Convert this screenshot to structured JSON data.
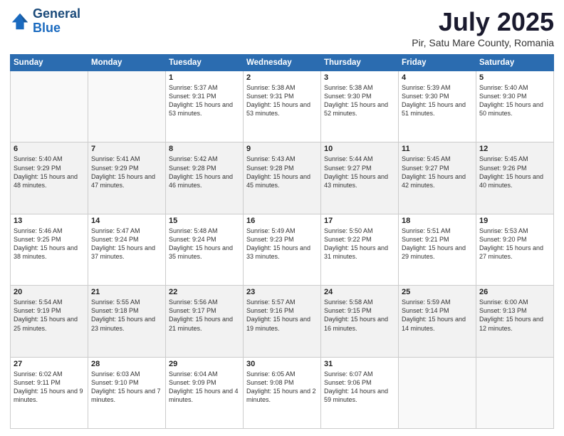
{
  "logo": {
    "line1": "General",
    "line2": "Blue"
  },
  "title": "July 2025",
  "subtitle": "Pir, Satu Mare County, Romania",
  "days_header": [
    "Sunday",
    "Monday",
    "Tuesday",
    "Wednesday",
    "Thursday",
    "Friday",
    "Saturday"
  ],
  "weeks": [
    [
      {
        "day": "",
        "info": ""
      },
      {
        "day": "",
        "info": ""
      },
      {
        "day": "1",
        "info": "Sunrise: 5:37 AM\nSunset: 9:31 PM\nDaylight: 15 hours and 53 minutes."
      },
      {
        "day": "2",
        "info": "Sunrise: 5:38 AM\nSunset: 9:31 PM\nDaylight: 15 hours and 53 minutes."
      },
      {
        "day": "3",
        "info": "Sunrise: 5:38 AM\nSunset: 9:30 PM\nDaylight: 15 hours and 52 minutes."
      },
      {
        "day": "4",
        "info": "Sunrise: 5:39 AM\nSunset: 9:30 PM\nDaylight: 15 hours and 51 minutes."
      },
      {
        "day": "5",
        "info": "Sunrise: 5:40 AM\nSunset: 9:30 PM\nDaylight: 15 hours and 50 minutes."
      }
    ],
    [
      {
        "day": "6",
        "info": "Sunrise: 5:40 AM\nSunset: 9:29 PM\nDaylight: 15 hours and 48 minutes."
      },
      {
        "day": "7",
        "info": "Sunrise: 5:41 AM\nSunset: 9:29 PM\nDaylight: 15 hours and 47 minutes."
      },
      {
        "day": "8",
        "info": "Sunrise: 5:42 AM\nSunset: 9:28 PM\nDaylight: 15 hours and 46 minutes."
      },
      {
        "day": "9",
        "info": "Sunrise: 5:43 AM\nSunset: 9:28 PM\nDaylight: 15 hours and 45 minutes."
      },
      {
        "day": "10",
        "info": "Sunrise: 5:44 AM\nSunset: 9:27 PM\nDaylight: 15 hours and 43 minutes."
      },
      {
        "day": "11",
        "info": "Sunrise: 5:45 AM\nSunset: 9:27 PM\nDaylight: 15 hours and 42 minutes."
      },
      {
        "day": "12",
        "info": "Sunrise: 5:45 AM\nSunset: 9:26 PM\nDaylight: 15 hours and 40 minutes."
      }
    ],
    [
      {
        "day": "13",
        "info": "Sunrise: 5:46 AM\nSunset: 9:25 PM\nDaylight: 15 hours and 38 minutes."
      },
      {
        "day": "14",
        "info": "Sunrise: 5:47 AM\nSunset: 9:24 PM\nDaylight: 15 hours and 37 minutes."
      },
      {
        "day": "15",
        "info": "Sunrise: 5:48 AM\nSunset: 9:24 PM\nDaylight: 15 hours and 35 minutes."
      },
      {
        "day": "16",
        "info": "Sunrise: 5:49 AM\nSunset: 9:23 PM\nDaylight: 15 hours and 33 minutes."
      },
      {
        "day": "17",
        "info": "Sunrise: 5:50 AM\nSunset: 9:22 PM\nDaylight: 15 hours and 31 minutes."
      },
      {
        "day": "18",
        "info": "Sunrise: 5:51 AM\nSunset: 9:21 PM\nDaylight: 15 hours and 29 minutes."
      },
      {
        "day": "19",
        "info": "Sunrise: 5:53 AM\nSunset: 9:20 PM\nDaylight: 15 hours and 27 minutes."
      }
    ],
    [
      {
        "day": "20",
        "info": "Sunrise: 5:54 AM\nSunset: 9:19 PM\nDaylight: 15 hours and 25 minutes."
      },
      {
        "day": "21",
        "info": "Sunrise: 5:55 AM\nSunset: 9:18 PM\nDaylight: 15 hours and 23 minutes."
      },
      {
        "day": "22",
        "info": "Sunrise: 5:56 AM\nSunset: 9:17 PM\nDaylight: 15 hours and 21 minutes."
      },
      {
        "day": "23",
        "info": "Sunrise: 5:57 AM\nSunset: 9:16 PM\nDaylight: 15 hours and 19 minutes."
      },
      {
        "day": "24",
        "info": "Sunrise: 5:58 AM\nSunset: 9:15 PM\nDaylight: 15 hours and 16 minutes."
      },
      {
        "day": "25",
        "info": "Sunrise: 5:59 AM\nSunset: 9:14 PM\nDaylight: 15 hours and 14 minutes."
      },
      {
        "day": "26",
        "info": "Sunrise: 6:00 AM\nSunset: 9:13 PM\nDaylight: 15 hours and 12 minutes."
      }
    ],
    [
      {
        "day": "27",
        "info": "Sunrise: 6:02 AM\nSunset: 9:11 PM\nDaylight: 15 hours and 9 minutes."
      },
      {
        "day": "28",
        "info": "Sunrise: 6:03 AM\nSunset: 9:10 PM\nDaylight: 15 hours and 7 minutes."
      },
      {
        "day": "29",
        "info": "Sunrise: 6:04 AM\nSunset: 9:09 PM\nDaylight: 15 hours and 4 minutes."
      },
      {
        "day": "30",
        "info": "Sunrise: 6:05 AM\nSunset: 9:08 PM\nDaylight: 15 hours and 2 minutes."
      },
      {
        "day": "31",
        "info": "Sunrise: 6:07 AM\nSunset: 9:06 PM\nDaylight: 14 hours and 59 minutes."
      },
      {
        "day": "",
        "info": ""
      },
      {
        "day": "",
        "info": ""
      }
    ]
  ]
}
